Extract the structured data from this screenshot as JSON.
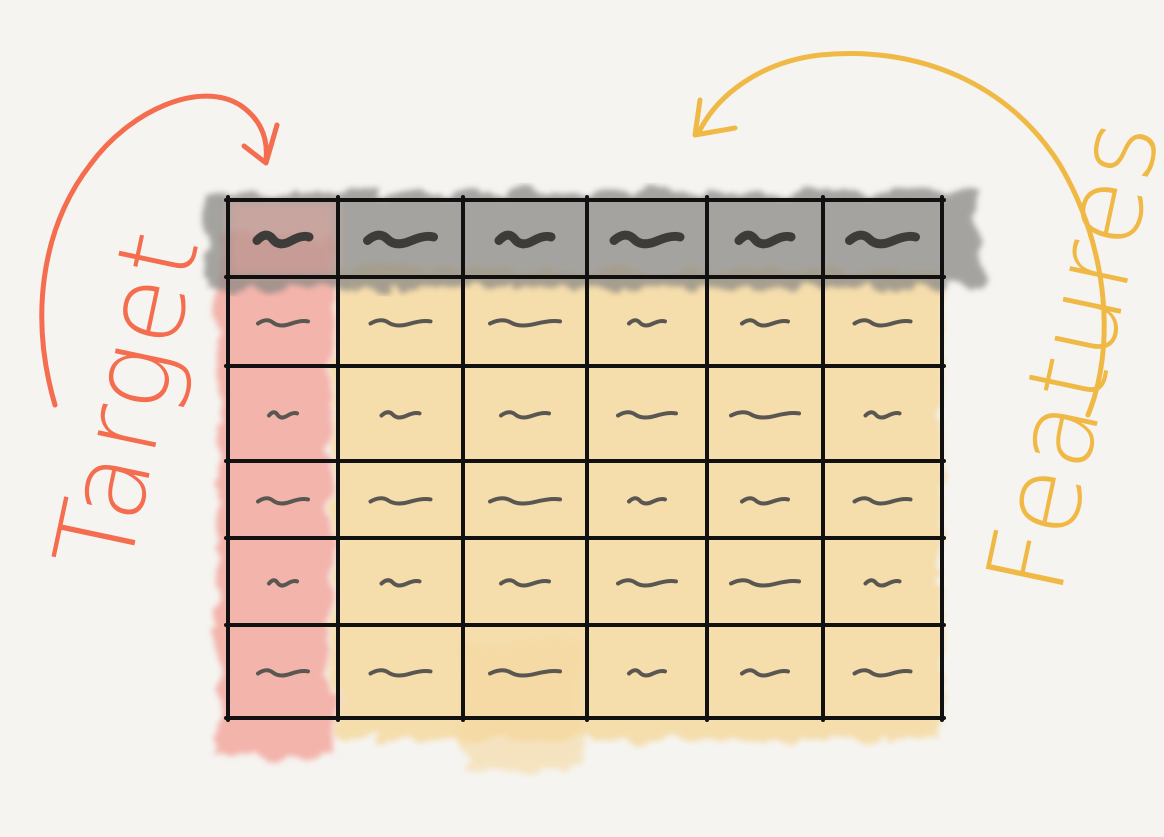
{
  "labels": {
    "target": "Target",
    "features": "Features"
  },
  "colors": {
    "background": "#f5f4f0",
    "target": "#f46d4e",
    "features": "#f0b945",
    "target_wash": "#f3a9a0",
    "features_wash": "#f5d9a1",
    "header_wash": "#8b8985",
    "grid": "#111111",
    "scribble": "#5a5752"
  },
  "table": {
    "header_row_count": 1,
    "body_row_count": 5,
    "column_count": 6,
    "target_column_index": 0
  }
}
